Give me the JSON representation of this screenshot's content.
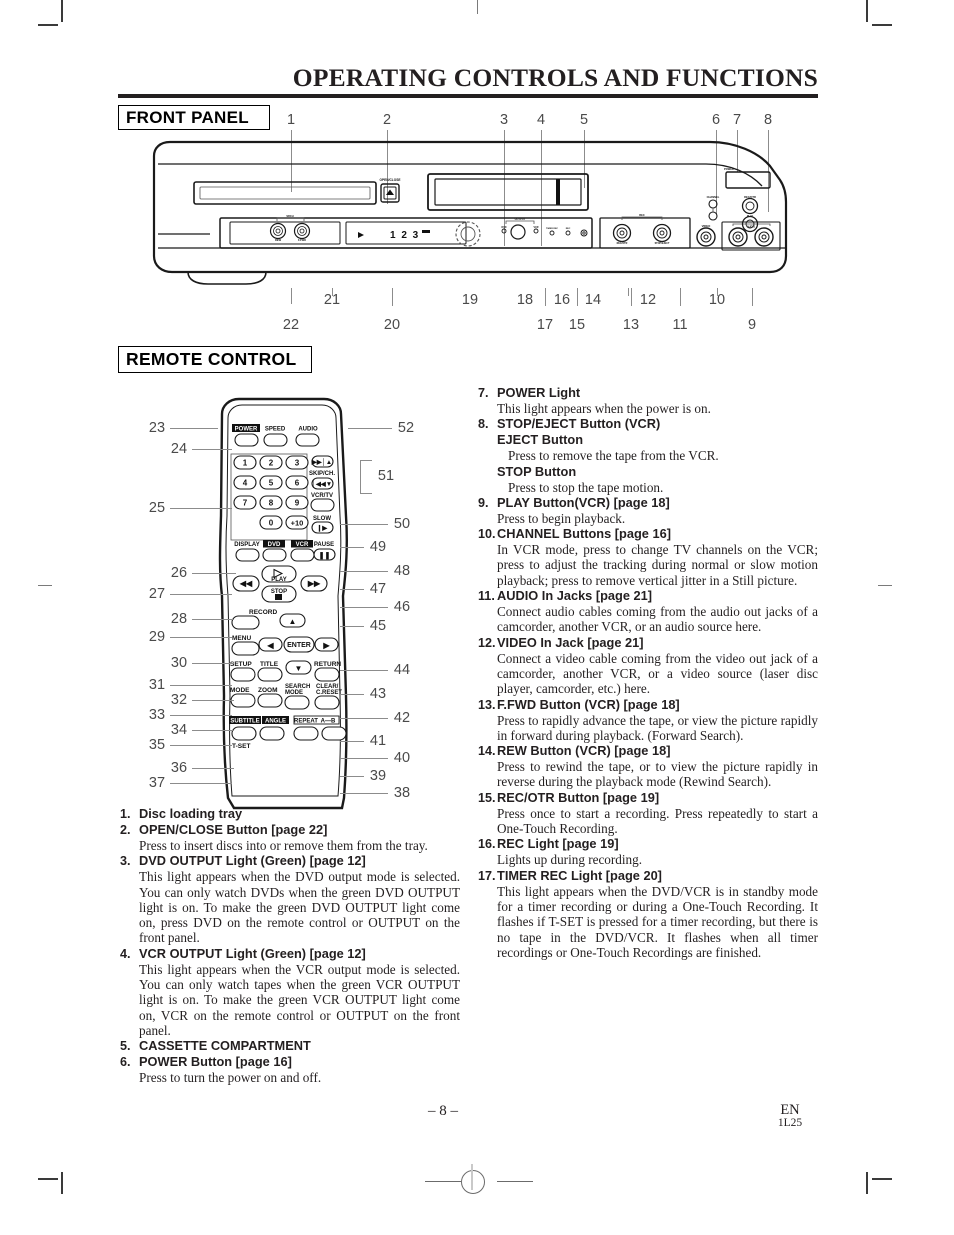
{
  "document": {
    "title": "OPERATING CONTROLS AND FUNCTIONS",
    "page_number": "– 8 –",
    "language_code": "EN",
    "part_code": "1L25"
  },
  "sections": {
    "front_panel_tag": "FRONT PANEL",
    "remote_control_tag": "REMOTE CONTROL"
  },
  "front_panel_callouts": {
    "top": [
      "1",
      "2",
      "3",
      "4",
      "5",
      "6",
      "7",
      "8"
    ],
    "bottom_upper": [
      "21",
      "19",
      "18",
      "16",
      "14",
      "12",
      "10"
    ],
    "bottom_lower": [
      "22",
      "20",
      "17",
      "15",
      "13",
      "11",
      "9"
    ]
  },
  "front_panel_labels": {
    "open_close": "OPEN/CLOSE",
    "output": "OUTPUT",
    "dvd": "DVD",
    "vcr": "VCR",
    "timer_rec": "TIMER REC",
    "rec": "REC",
    "search": "SRCH",
    "rew": "REW",
    "ffwd": "F.FWD",
    "video": "VIDEO",
    "audio": "AUDIO",
    "power": "POWER",
    "channel": "CHANNEL",
    "rec_otr": "REC/OTR",
    "play": "PLAY",
    "display_text": "1 2 3"
  },
  "remote_callouts": {
    "left": [
      "23",
      "24",
      "25",
      "26",
      "27",
      "28",
      "29",
      "30",
      "31",
      "32",
      "33",
      "34",
      "35",
      "36",
      "37"
    ],
    "right": [
      "52",
      "51",
      "50",
      "49",
      "48",
      "47",
      "46",
      "45",
      "44",
      "43",
      "42",
      "41",
      "40",
      "39",
      "38"
    ]
  },
  "remote_labels": {
    "power": "POWER",
    "speed": "SPEED",
    "audio": "AUDIO",
    "keys": [
      "1",
      "2",
      "3",
      "4",
      "5",
      "6",
      "7",
      "8",
      "9",
      "0",
      "+10"
    ],
    "skip_ch": "SKIP/CH.",
    "vcr_tv": "VCR/TV",
    "slow": "SLOW",
    "display": "DISPLAY",
    "dvd": "DVD",
    "vcr": "VCR",
    "pause": "PAUSE",
    "play": "PLAY",
    "stop": "STOP",
    "record": "RECORD",
    "menu": "MENU",
    "setup": "SETUP",
    "title": "TITLE",
    "enter": "ENTER",
    "return": "RETURN",
    "mode": "MODE",
    "zoom": "ZOOM",
    "search_mode": "SEARCH MODE",
    "clear_creset": "CLEAR/ C.RESET",
    "subtitle": "SUBTITLE",
    "angle": "ANGLE",
    "repeat": "REPEAT",
    "a_b": "A—B",
    "t_set": "T-SET"
  },
  "list_left": [
    {
      "num": "1.",
      "title": "Disc loading tray",
      "desc": ""
    },
    {
      "num": "2.",
      "title": "OPEN/CLOSE Button [page 22]",
      "desc": "Press to insert discs into or remove them from the tray."
    },
    {
      "num": "3.",
      "title": "DVD OUTPUT Light (Green) [page 12]",
      "desc": "This light appears when the DVD output mode is selected. You can only watch DVDs when the green DVD OUTPUT light is on. To make the green DVD OUTPUT light come on, press DVD on the remote control or OUTPUT on the front panel."
    },
    {
      "num": "4.",
      "title": "VCR OUTPUT Light (Green) [page 12]",
      "desc": "This light appears when the VCR output mode is selected. You can only watch tapes when the green VCR OUTPUT light is on. To make the green VCR OUTPUT light come on, VCR on the remote control or OUTPUT on the front panel."
    },
    {
      "num": "5.",
      "title": "CASSETTE COMPARTMENT",
      "desc": ""
    },
    {
      "num": "6.",
      "title": "POWER Button [page 16]",
      "desc": "Press to turn the power on and off."
    }
  ],
  "list_right": [
    {
      "num": "7.",
      "title": "POWER Light",
      "desc": "This light appears when the power is on."
    },
    {
      "num": "8.",
      "title": "STOP/EJECT Button (VCR)",
      "subtitle1": "EJECT Button",
      "subdesc1": "Press to remove the tape from the VCR.",
      "subtitle2": "STOP Button",
      "subdesc2": "Press to stop the tape motion.",
      "desc": ""
    },
    {
      "num": "9.",
      "title": "PLAY Button(VCR) [page 18]",
      "desc": "Press to begin playback."
    },
    {
      "num": "10.",
      "title": "CHANNEL Buttons [page 16]",
      "desc": "In VCR mode, press to change TV channels on the VCR; press to adjust the tracking during normal or slow motion playback; press to remove vertical jitter in a Still picture."
    },
    {
      "num": "11.",
      "title": "AUDIO In Jacks [page 21]",
      "desc": "Connect audio cables coming from the audio out jacks of a camcorder, another VCR, or an audio source here."
    },
    {
      "num": "12.",
      "title": "VIDEO In Jack [page 21]",
      "desc": "Connect a video cable coming from the video out jack of a camcorder, another VCR, or a video source (laser disc player, camcorder, etc.) here."
    },
    {
      "num": "13.",
      "title": "F.FWD Button (VCR) [page 18]",
      "desc": "Press to rapidly advance the tape, or view the picture rapidly in forward during playback. (Forward Search)."
    },
    {
      "num": "14.",
      "title": "REW Button (VCR) [page 18]",
      "desc": "Press to rewind the tape, or to view the picture rapidly in reverse during the playback mode (Rewind Search)."
    },
    {
      "num": "15.",
      "title": "REC/OTR Button [page 19]",
      "desc": "Press once to start a recording. Press repeatedly to start a One-Touch Recording."
    },
    {
      "num": "16.",
      "title": "REC Light [page 19]",
      "desc": "Lights up during recording."
    },
    {
      "num": "17.",
      "title": "TIMER REC Light [page 20]",
      "desc": "This light appears when the DVD/VCR is in standby mode for a timer recording or during a One-Touch Recording. It flashes if T-SET is pressed for a timer recording, but there is no tape in the DVD/VCR. It flashes when all timer recordings or One-Touch Recordings are finished."
    }
  ],
  "colors": {
    "ink": "#231f20",
    "rule": "#231f20",
    "leader": "#8c8c8c",
    "callout": "#4a4a4a"
  }
}
